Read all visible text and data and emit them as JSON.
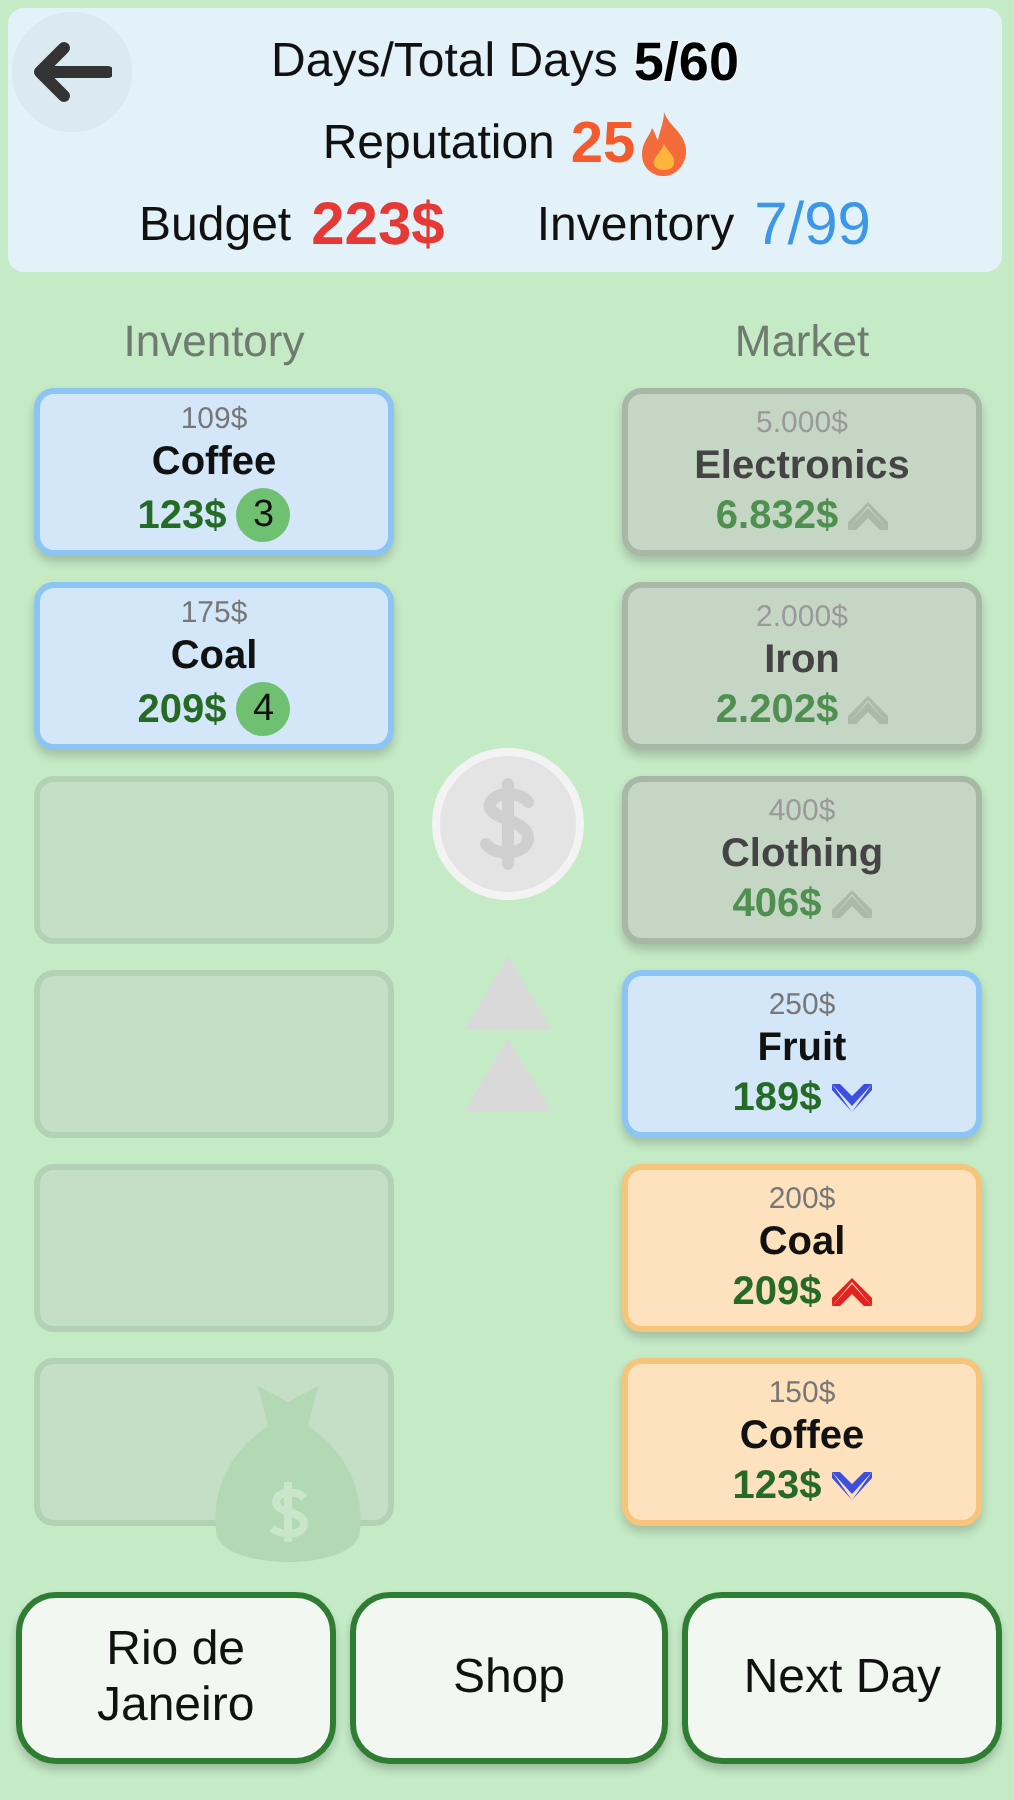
{
  "header": {
    "days_label": "Days/Total Days",
    "days_value": "5/60",
    "reputation_label": "Reputation",
    "reputation_value": "25",
    "budget_label": "Budget",
    "budget_value": "223$",
    "inventory_label": "Inventory",
    "inventory_value": "7/99"
  },
  "inventory": {
    "title": "Inventory",
    "slots": [
      {
        "kind": "item",
        "buy_price": "109$",
        "name": "Coffee",
        "price": "123$",
        "count": "3"
      },
      {
        "kind": "item",
        "buy_price": "175$",
        "name": "Coal",
        "price": "209$",
        "count": "4"
      },
      {
        "kind": "empty"
      },
      {
        "kind": "empty"
      },
      {
        "kind": "empty"
      },
      {
        "kind": "empty"
      }
    ]
  },
  "market": {
    "title": "Market",
    "items": [
      {
        "base_price": "5.000$",
        "name": "Electronics",
        "price": "6.832$",
        "kind": "up",
        "disabled": true,
        "selected": false
      },
      {
        "base_price": "2.000$",
        "name": "Iron",
        "price": "2.202$",
        "kind": "up",
        "disabled": true,
        "selected": false
      },
      {
        "base_price": "400$",
        "name": "Clothing",
        "price": "406$",
        "kind": "up",
        "disabled": true,
        "selected": false
      },
      {
        "base_price": "250$",
        "name": "Fruit",
        "price": "189$",
        "kind": "down",
        "disabled": false,
        "selected": true
      },
      {
        "base_price": "200$",
        "name": "Coal",
        "price": "209$",
        "kind": "up",
        "disabled": false,
        "selected": false
      },
      {
        "base_price": "150$",
        "name": "Coffee",
        "price": "123$",
        "kind": "down",
        "disabled": false,
        "selected": false
      }
    ]
  },
  "buttons": [
    "Rio de Janeiro",
    "Shop",
    "Next Day"
  ]
}
